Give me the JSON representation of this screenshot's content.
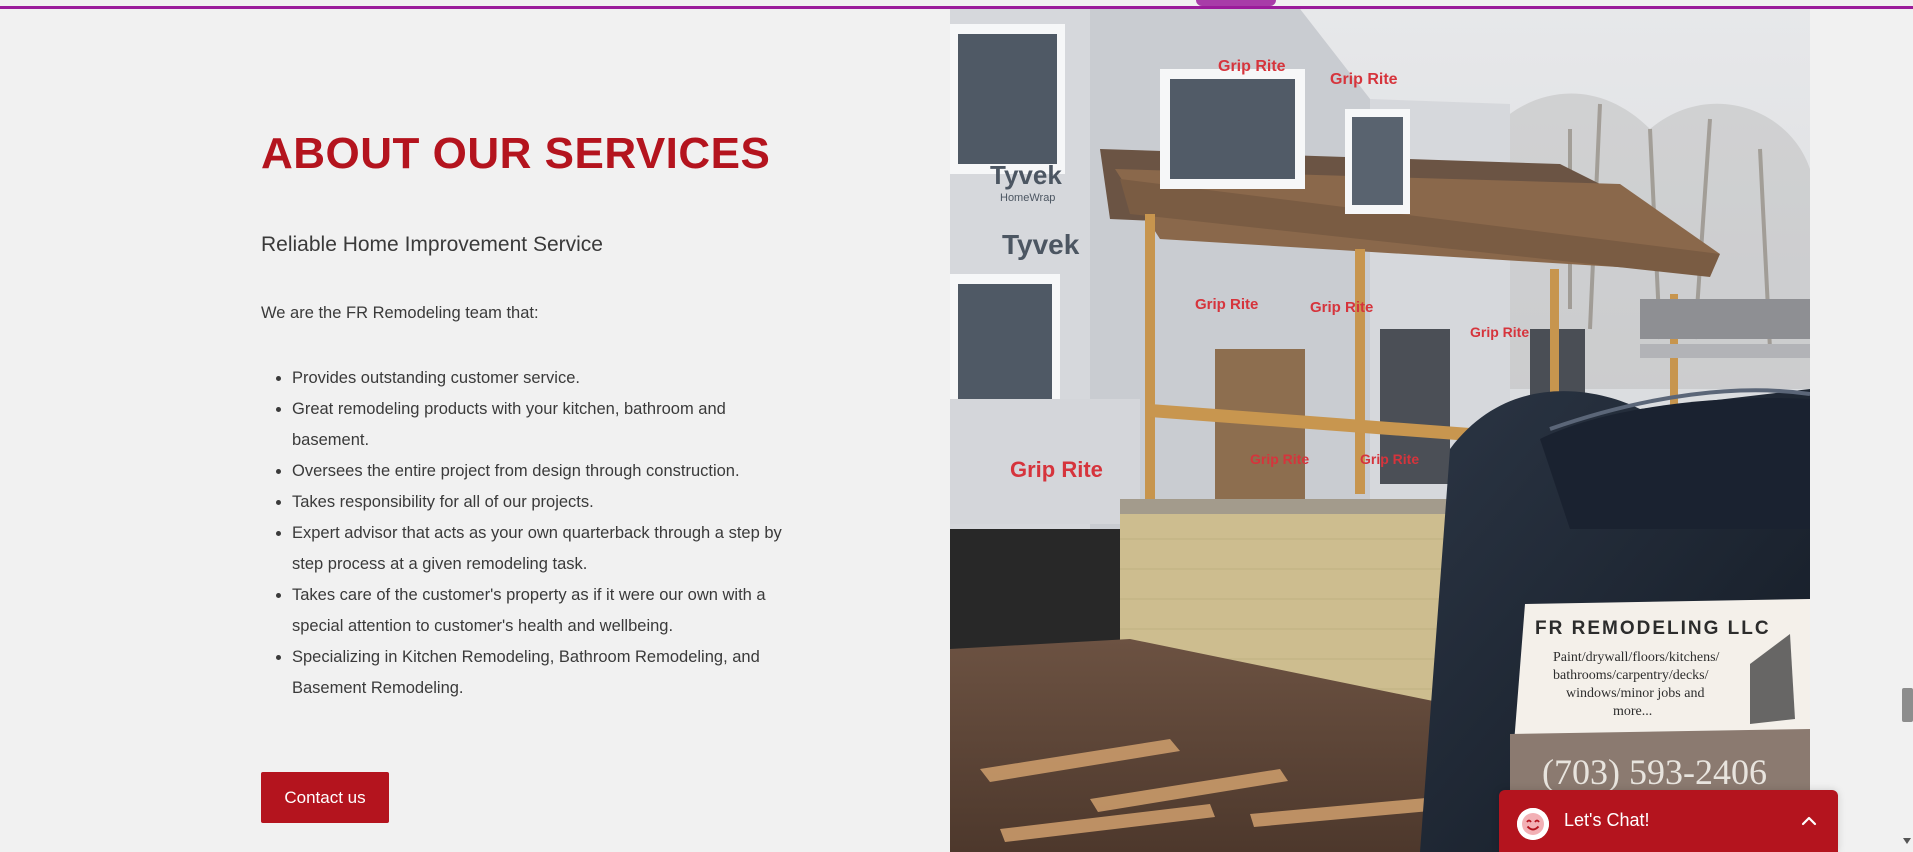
{
  "section": {
    "title": "ABOUT OUR SERVICES",
    "subtitle": "Reliable Home Improvement Service",
    "intro": "We are the FR Remodeling team that:",
    "items": [
      "Provides outstanding customer service.",
      "Great remodeling products with your kitchen, bathroom and basement.",
      "Oversees the entire project from design through construction.",
      "Takes responsibility for all of our projects.",
      "Expert advisor that acts as your own quarterback through a step by step process at a given remodeling task.",
      "Takes care of the customer's property as if it were our own with a special attention to customer's health and wellbeing.",
      "Specializing in Kitchen Remodeling, Bathroom Remodeling, and Basement Remodeling."
    ],
    "contact_label": "Contact us"
  },
  "photo": {
    "sign_company": "FR REMODELING LLC",
    "sign_services_1": "Paint/drywall/floors/kitchens/",
    "sign_services_2": "bathrooms/carpentry/decks/",
    "sign_services_3": "windows/minor jobs and",
    "sign_services_4": "more...",
    "sign_phone": "(703) 593-2406",
    "wrap_brand_1": "Tyvek",
    "wrap_brand_2": "HomeWrap",
    "wrap_brand_3": "Grip Rite"
  },
  "chat": {
    "label": "Let's Chat!",
    "icon": "smile-icon",
    "toggle_icon": "chevron-up-icon"
  },
  "colors": {
    "accent": "#b4141e",
    "top_rule": "#9b1c9b",
    "background": "#f1f1f1"
  }
}
